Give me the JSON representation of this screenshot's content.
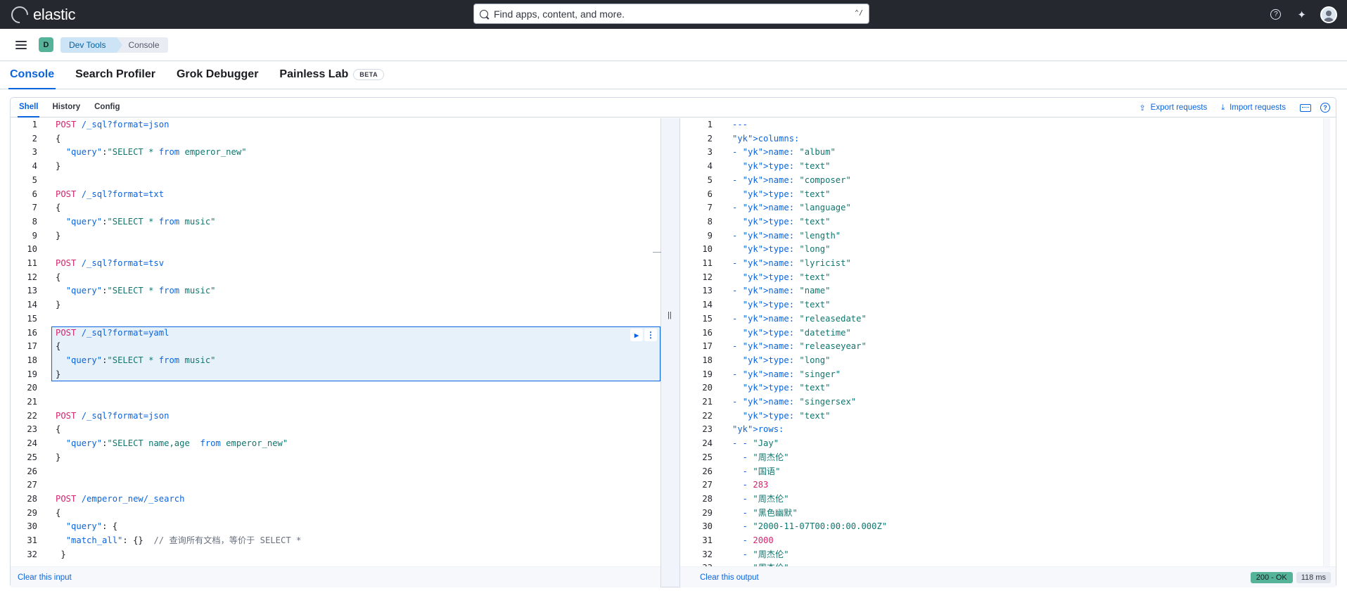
{
  "app": {
    "brand": "elastic",
    "search_placeholder": "Find apps, content, and more.",
    "search_shortcut": "⌃/"
  },
  "nav": {
    "space_initial": "D",
    "breadcrumbs": [
      "Dev Tools",
      "Console"
    ]
  },
  "tabs": [
    "Console",
    "Search Profiler",
    "Grok Debugger",
    "Painless Lab"
  ],
  "beta_badge": "BETA",
  "subtabs": [
    "Shell",
    "History",
    "Config"
  ],
  "actions": {
    "export": "Export requests",
    "import": "Import requests"
  },
  "colors": {
    "accent": "#0b64dd",
    "header_bg": "#25282f",
    "status_ok": "#54b399"
  },
  "request_lines": [
    "POST /_sql?format=json",
    "{",
    "  \"query\":\"SELECT * from emperor_new\"",
    "}",
    "",
    "POST /_sql?format=txt",
    "{",
    "  \"query\":\"SELECT * from music\"",
    "}",
    "",
    "POST /_sql?format=tsv",
    "{",
    "  \"query\":\"SELECT * from music\"",
    "}",
    "",
    "POST /_sql?format=yaml",
    "{",
    "  \"query\":\"SELECT * from music\"",
    "}",
    "",
    "",
    "POST /_sql?format=json",
    "{",
    "  \"query\":\"SELECT name,age  from emperor_new\"",
    "}",
    "",
    "",
    "POST /emperor_new/_search",
    "{",
    "  \"query\": {",
    "  \"match_all\": {}  // 查询所有文档，等价于 SELECT *",
    " }"
  ],
  "response_lines": [
    "---",
    "columns:",
    "- name: \"album\"",
    "  type: \"text\"",
    "- name: \"composer\"",
    "  type: \"text\"",
    "- name: \"language\"",
    "  type: \"text\"",
    "- name: \"length\"",
    "  type: \"long\"",
    "- name: \"lyricist\"",
    "  type: \"text\"",
    "- name: \"name\"",
    "  type: \"text\"",
    "- name: \"releasedate\"",
    "  type: \"datetime\"",
    "- name: \"releaseyear\"",
    "  type: \"long\"",
    "- name: \"singer\"",
    "  type: \"text\"",
    "- name: \"singersex\"",
    "  type: \"text\"",
    "rows:",
    "- - \"Jay\"",
    "  - \"周杰伦\"",
    "  - \"国语\"",
    "  - 283",
    "  - \"周杰伦\"",
    "  - \"黑色幽默\"",
    "  - \"2000-11-07T00:00:00.000Z\"",
    "  - 2000",
    "  - \"周杰伦\"",
    "  - \"周杰伦\""
  ],
  "footer": {
    "clear_input": "Clear this input",
    "clear_output": "Clear this output",
    "status": "200 - OK",
    "time": "118 ms"
  }
}
